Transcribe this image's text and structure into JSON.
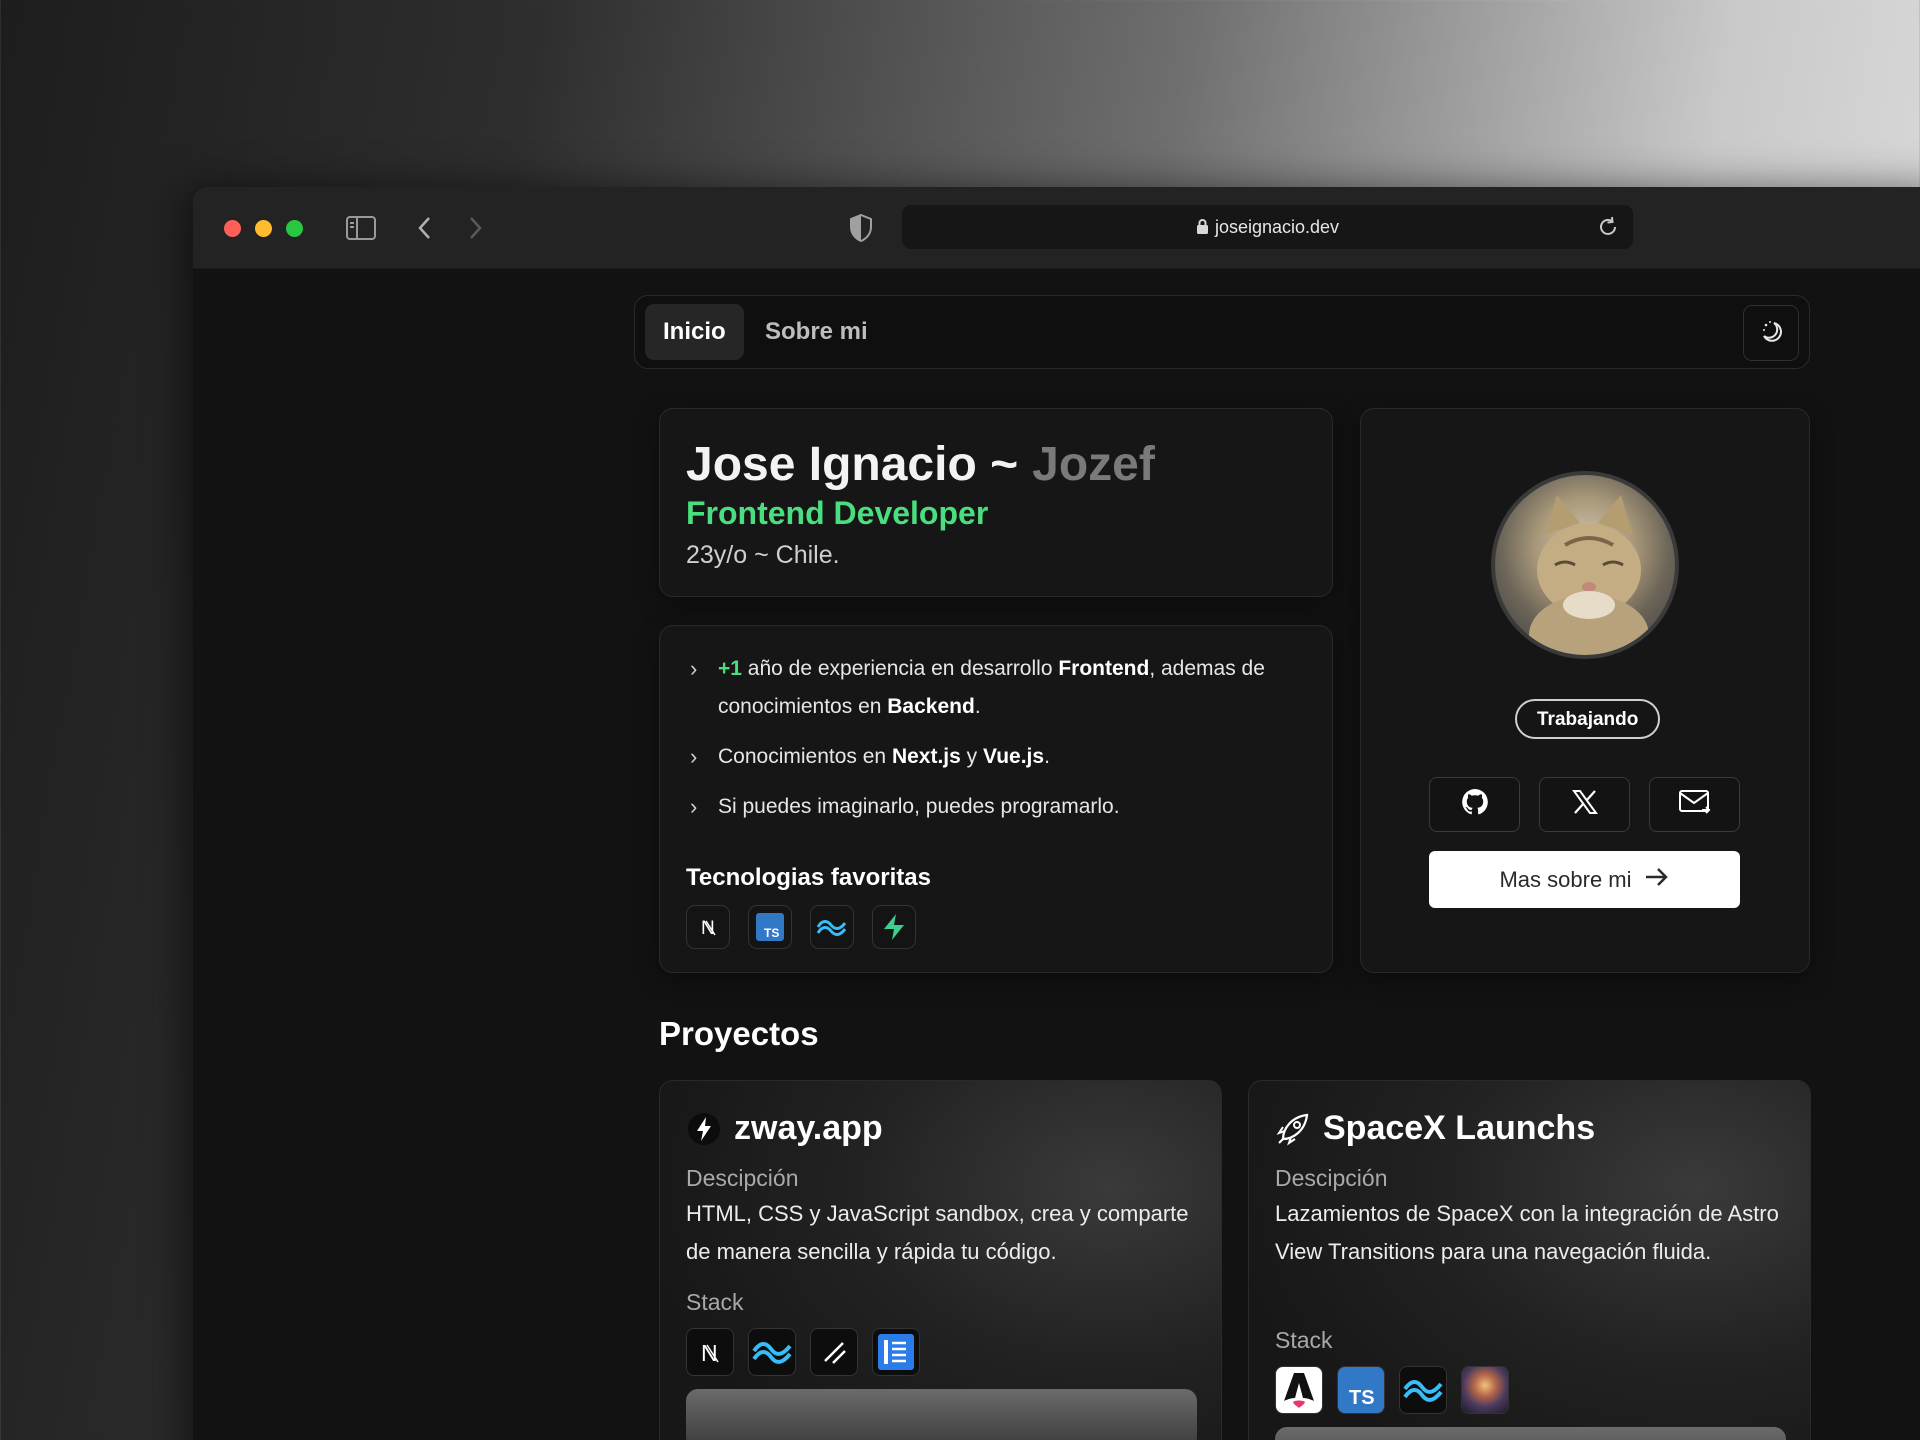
{
  "browser": {
    "url": "joseignacio.dev",
    "traffic_lights": [
      "#ff5f57",
      "#febc2e",
      "#28c840"
    ]
  },
  "nav": {
    "tabs": [
      {
        "label": "Inicio",
        "active": true
      },
      {
        "label": "Sobre mi",
        "active": false
      }
    ],
    "theme_icon": "moon-stars-icon"
  },
  "hero": {
    "name": "Jose Ignacio ~",
    "alias": "Jozef",
    "role": "Frontend Developer",
    "location": "23y/o ~ Chile.",
    "accent": "#4ade80"
  },
  "about": {
    "bullet1": {
      "highlight": "+1",
      "p1": " año de experiencia en desarrollo ",
      "b1": "Frontend",
      "p2": ", ademas de conocimientos en ",
      "b2": "Backend",
      "p3": "."
    },
    "bullet2": {
      "p1": "Conocimientos en ",
      "b1": "Next.js",
      "p2": " y ",
      "b2": "Vue.js",
      "p3": "."
    },
    "bullet3": "Si puedes imaginarlo, puedes programarlo.",
    "favorites_title": "Tecnologias favoritas",
    "favorites": [
      "nextjs-icon",
      "typescript-icon",
      "tailwind-icon",
      "supabase-icon"
    ]
  },
  "profile": {
    "status": "Trabajando",
    "socials": [
      "github-icon",
      "x-icon",
      "mail-icon"
    ],
    "more_button": "Mas sobre mi"
  },
  "projects": {
    "title": "Proyectos",
    "items": [
      {
        "name": "zway.app",
        "icon": "bolt-icon",
        "desc_label": "Descipción",
        "description": "HTML, CSS y JavaScript sandbox, crea y comparte de manera sencilla y rápida tu código.",
        "stack_label": "Stack",
        "stack": [
          "nextjs-icon",
          "tailwind-icon",
          "shadcn-icon",
          "library-icon"
        ]
      },
      {
        "name": "SpaceX Launchs",
        "icon": "rocket-icon",
        "desc_label": "Descipción",
        "description": "Lazamientos de SpaceX con la integración de Astro View Transitions para una navegación fluida.",
        "stack_label": "Stack",
        "stack": [
          "astro-icon",
          "typescript-icon",
          "tailwind-icon",
          "space-image-icon"
        ]
      }
    ]
  }
}
